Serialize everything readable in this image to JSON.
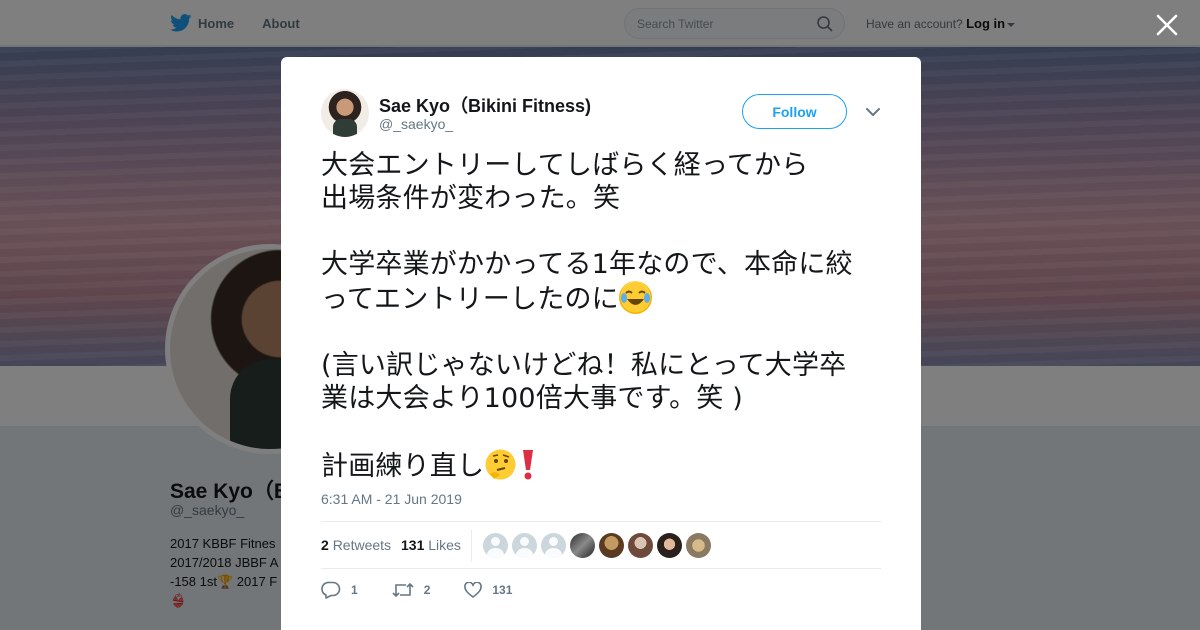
{
  "topbar": {
    "nav": [
      {
        "label": "Home",
        "icon": "twitter-bird-icon"
      },
      {
        "label": "About"
      }
    ],
    "search": {
      "placeholder": "Search Twitter"
    },
    "account_prompt": "Have an account?",
    "login_label": "Log in"
  },
  "profile": {
    "name": "Sae Kyo（B",
    "handle": "@_saekyo_",
    "bio": "2017 KBBF Fitnes\n2017/2018 JBBF A\n-158 1st🏆 2017 F\n👙"
  },
  "tweet": {
    "author_name": "Sae Kyo（Bikini Fitness)",
    "author_handle": "@_saekyo_",
    "follow_label": "Follow",
    "text_p1": "大会エントリーしてしばらく経ってから\n出場条件が変わった。笑",
    "text_p2": "大学卒業がかかってる1年なので、本命に絞\nってエントリーしたのに",
    "text_p3": "(言い訳じゃないけどね！私にとって大学卒\n業は大会より100倍大事です。笑 )",
    "text_p4": "計画練り直し",
    "emojis": [
      "face-with-tears-of-joy",
      "thinking-face",
      "red-exclamation"
    ],
    "timestamp": "6:31 AM - 21 Jun 2019",
    "retweets_count": "2",
    "retweets_label": "Retweets",
    "likes_count": "131",
    "likes_label": "Likes",
    "actions": {
      "reply_count": "1",
      "retweet_count": "2",
      "like_count": "131"
    }
  },
  "colors": {
    "accent": "#1da1f2",
    "text": "#14171a",
    "muted": "#657786"
  }
}
